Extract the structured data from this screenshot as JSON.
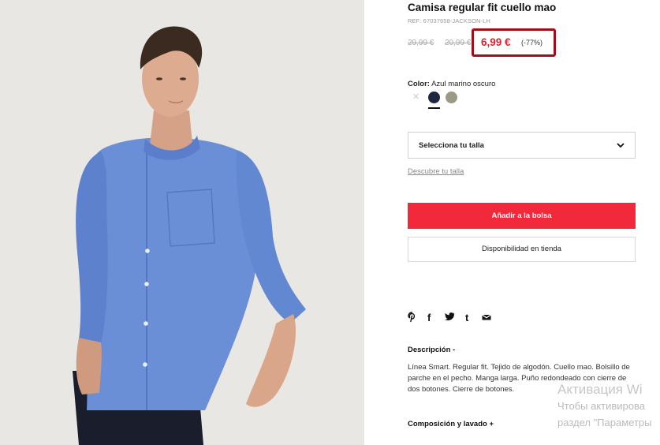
{
  "product": {
    "title": "Camisa regular fit cuello mao",
    "ref": "REF: 67037658-JACKSON-LH",
    "old_price_1": "29,99 €",
    "old_price_2": "20,99 €",
    "price": "6,99 €",
    "discount": "(-77%)",
    "accent_color": "#f2283b",
    "highlight_border_color": "#a10d1a"
  },
  "color": {
    "label": "Color:",
    "value": "Azul marino oscuro",
    "swatches": [
      {
        "name": "blanco",
        "hex": "#ffffff",
        "unavailable": true
      },
      {
        "name": "azul marino oscuro",
        "hex": "#1e2740",
        "selected": true
      },
      {
        "name": "gris",
        "hex": "#9c9a86"
      }
    ]
  },
  "size": {
    "select_label": "Selecciona tu talla",
    "guide_link": "Descubre tu talla"
  },
  "actions": {
    "add_to_bag": "Añadir a la bolsa",
    "store_availability": "Disponibilidad en tienda"
  },
  "share": {
    "icons": [
      "pinterest-icon",
      "facebook-icon",
      "twitter-icon",
      "tumblr-icon",
      "email-icon"
    ]
  },
  "description": {
    "title": "Descripción -",
    "text": "Línea Smart. Regular fit. Tejido de algodón. Cuello mao. Bolsillo de parche en el pecho. Manga larga. Puño redondeado con cierre de dos botones. Cierre de botones."
  },
  "composition": {
    "title": "Composición y lavado +"
  },
  "watermark": {
    "line1": "Активация Wi",
    "line2": "Чтобы активирова",
    "line3": "раздел \"Параметры"
  }
}
